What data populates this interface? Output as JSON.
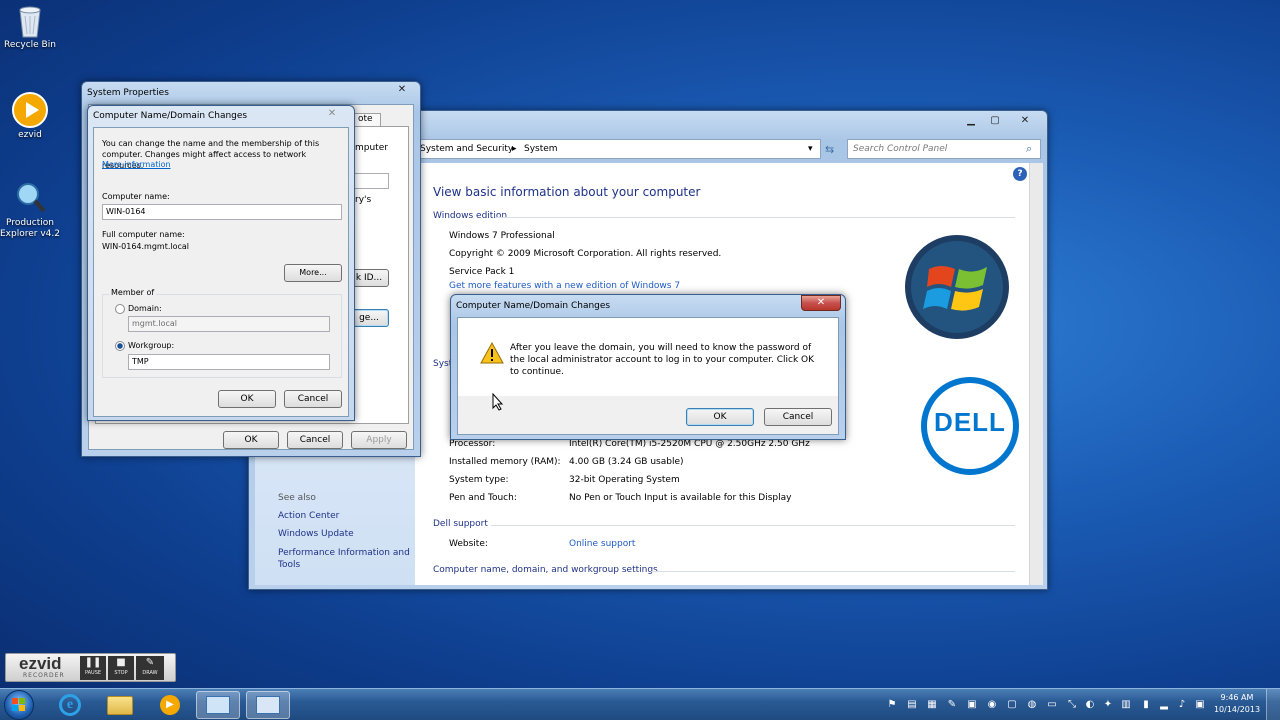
{
  "desktop": {
    "icons": [
      {
        "label": "Recycle Bin"
      },
      {
        "label": "ezvid"
      },
      {
        "label": "Production Explorer v4.2"
      }
    ]
  },
  "ezvid_bar": {
    "logo_top": "ezvid",
    "logo_bottom": "RECORDER",
    "pause": "PAUSE",
    "stop": "STOP",
    "draw": "DRAW"
  },
  "control_panel": {
    "breadcrumb_1": "System and Security",
    "breadcrumb_2": "System",
    "search_placeholder": "Search Control Panel",
    "title": "View basic information about your computer",
    "windows_edition": {
      "heading": "Windows edition",
      "edition": "Windows 7 Professional",
      "copyright": "Copyright © 2009 Microsoft Corporation.  All rights reserved.",
      "service_pack": "Service Pack 1",
      "more_features": "Get more features with a new edition of Windows 7"
    },
    "system_heading_partial": "Syst",
    "processor_label": "Processor:",
    "processor_value": "Intel(R) Core(TM) i5-2520M CPU @ 2.50GHz   2.50 GHz",
    "memory_label": "Installed memory (RAM):",
    "memory_value": "4.00 GB (3.24 GB usable)",
    "system_type_label": "System type:",
    "system_type_value": "32-bit Operating System",
    "pen_label": "Pen and Touch:",
    "pen_value": "No Pen or Touch Input is available for this Display",
    "dell_support": {
      "heading": "Dell support",
      "website_label": "Website:",
      "website_value": "Online support"
    },
    "computer_name_heading": "Computer name, domain, and workgroup settings",
    "see_also": {
      "heading": "See also",
      "items": [
        "Action Center",
        "Windows Update",
        "Performance Information and Tools"
      ]
    },
    "dell_logo": "DELL"
  },
  "system_properties": {
    "title": "System Properties",
    "partial_tab": "ote",
    "partial_text_1": "mputer",
    "partial_text_2": "ry's",
    "partial_btn_1": "k ID...",
    "partial_btn_2": "ge...",
    "ok": "OK",
    "cancel": "Cancel",
    "apply": "Apply"
  },
  "name_changes": {
    "title": "Computer Name/Domain Changes",
    "intro": "You can change the name and the membership of this computer. Changes might affect access to network resources.",
    "more_info": "More information",
    "computer_name_label": "Computer name:",
    "computer_name_value": "WIN-0164",
    "full_name_label": "Full computer name:",
    "full_name_value": "WIN-0164.mgmt.local",
    "more_button": "More...",
    "member_of": "Member of",
    "domain_label": "Domain:",
    "domain_value": "mgmt.local",
    "workgroup_label": "Workgroup:",
    "workgroup_value": "TMP",
    "ok": "OK",
    "cancel": "Cancel"
  },
  "alert": {
    "title": "Computer Name/Domain Changes",
    "message": "After you leave the domain, you will need to know the password of the local administrator account to log in to your computer. Click OK to continue.",
    "ok": "OK",
    "cancel": "Cancel"
  },
  "taskbar": {
    "time": "9:46 AM",
    "date": "10/14/2013"
  }
}
